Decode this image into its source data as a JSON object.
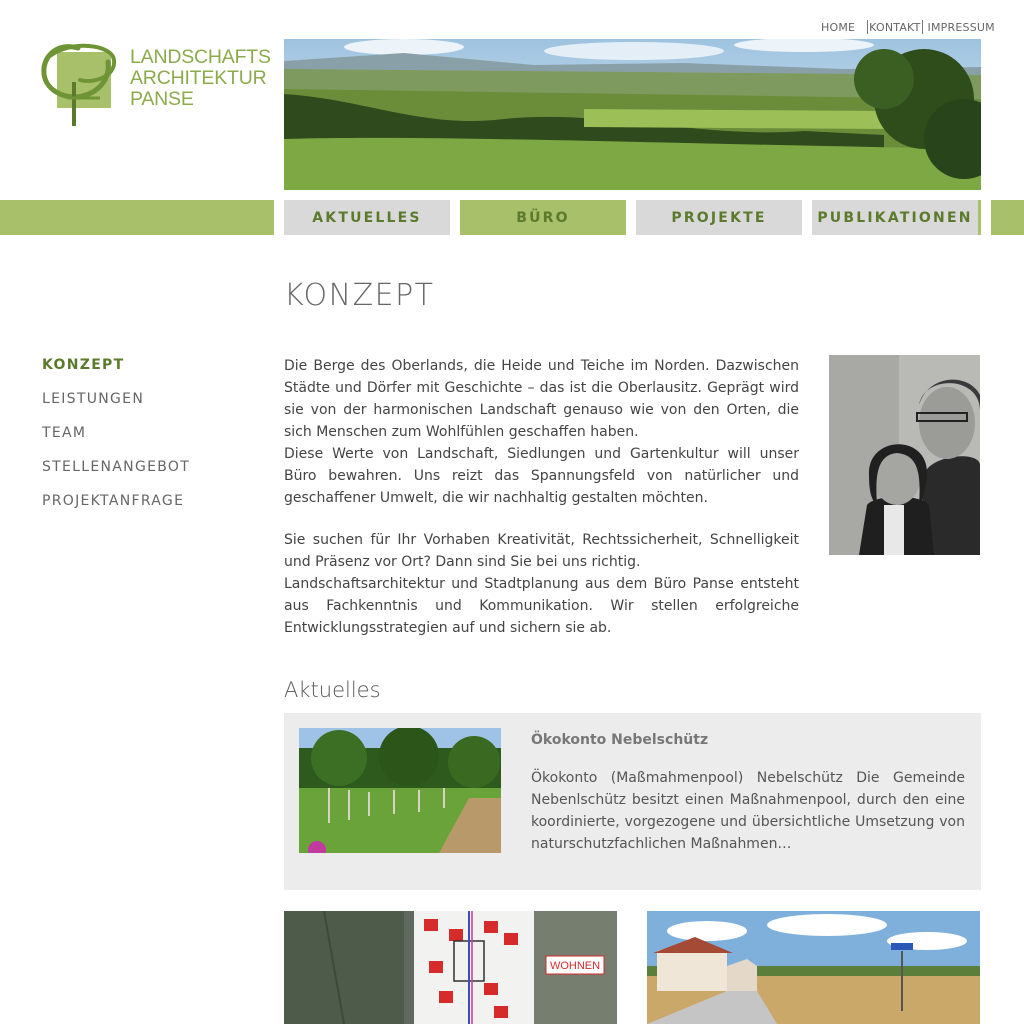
{
  "toplinks": {
    "home": "HOME",
    "kontakt": "KONTAKT",
    "impressum": "IMPRESSUM"
  },
  "logo": {
    "line1": "LANDSCHAFTS",
    "line2": "ARCHITEKTUR",
    "line3": "PANSE"
  },
  "nav": [
    "AKTUELLES",
    "BÜRO",
    "PROJEKTE",
    "PUBLIKATIONEN"
  ],
  "nav_active_index": 1,
  "colors": {
    "accent": "#a9c06a",
    "accent_text": "#5b7a2c",
    "logo": "#8cab4c",
    "nav_inactive": "#d9d9d9",
    "box_bg": "#ececec"
  },
  "page_title": "KONZEPT",
  "sidenav": [
    "KONZEPT",
    "LEISTUNGEN",
    "TEAM",
    "STELLENANGEBOT",
    "PROJEKTANFRAGE"
  ],
  "body": {
    "p1": "Die Berge des Oberlands, die Heide und Teiche im Norden. Dazwischen Städte und Dörfer mit Geschichte – das ist die Oberlausitz. Geprägt wird sie von der harmonischen Landschaft genauso wie von den Orten, die sich Menschen zum Wohlfühlen geschaffen haben.",
    "p2": "Diese Werte von Landschaft, Siedlungen und Gartenkultur will unser Büro bewahren. Uns reizt das Spannungsfeld von natürlicher und geschaffener Umwelt, die wir nachhaltig gestalten möchten.",
    "p3": "Sie suchen für Ihr Vorhaben Kreativität, Rechtssicherheit, Schnelligkeit und Präsenz vor Ort? Dann sind Sie bei uns richtig.",
    "p4": "Landschaftsarchitektur und Stadtplanung aus dem Büro Panse entsteht aus Fachkenntnis und Kommunikation. Wir stellen erfolgreiche Entwicklungsstrategien auf und sichern sie ab."
  },
  "aktuelles": {
    "title": "Aktuelles",
    "news_title": "Ökokonto Nebelschütz",
    "news_text": "Ökokonto (Maßmahmenpool) Nebelschütz Die Gemeinde Nebenlschütz besitzt einen Maßnahmenpool, durch den eine koordinierte, vorgezogene und übersichtliche Umsetzung von naturschutzfachlichen Maßnahmen…",
    "plan_label": "WOHNEN"
  }
}
